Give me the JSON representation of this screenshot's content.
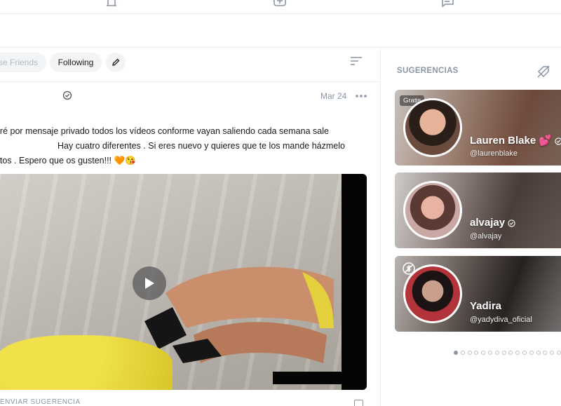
{
  "filters": {
    "close_friends": "se Friends",
    "following": "Following"
  },
  "post": {
    "date": "Mar 24",
    "text_lines": [
      "daré por mensaje privado todos los vídeos conforme vayan saliendo cada semana sale",
      "Hay cuatro diferentes . Si eres nuevo y quieres que te los mande házmelo",
      "entos . Espero que os gusten!!! 🧡😘"
    ],
    "footer_label": "ENVIAR SUGERENCIA"
  },
  "sidebar": {
    "title": "SUGERENCIAS",
    "cards": [
      {
        "name": "Lauren Blake 💕",
        "handle": "@laurenblake",
        "badge": "Gratis",
        "avatar_color": "#d9a58c",
        "bg_color": "#b88c7a"
      },
      {
        "name": "alvajay",
        "handle": "@alvajay",
        "badge": "",
        "avatar_color": "#e0a7a2",
        "bg_color": "#9a8b88"
      },
      {
        "name": "Yadira",
        "handle": "@yadydiva_oficial",
        "badge": "",
        "avatar_color": "#b43a3e",
        "bg_color": "#6f6a6b"
      }
    ],
    "pager": {
      "total": 16,
      "active_index": 0
    }
  },
  "colors": {
    "muted": "#8a96a3",
    "chip_bg": "#f2f4f5"
  },
  "icons": [
    "bell-icon",
    "add-post-icon",
    "messages-icon",
    "pencil-icon",
    "sort-icon",
    "verified-icon",
    "more-icon",
    "play-icon",
    "hide-suggestions-icon",
    "no-dollar-icon"
  ]
}
